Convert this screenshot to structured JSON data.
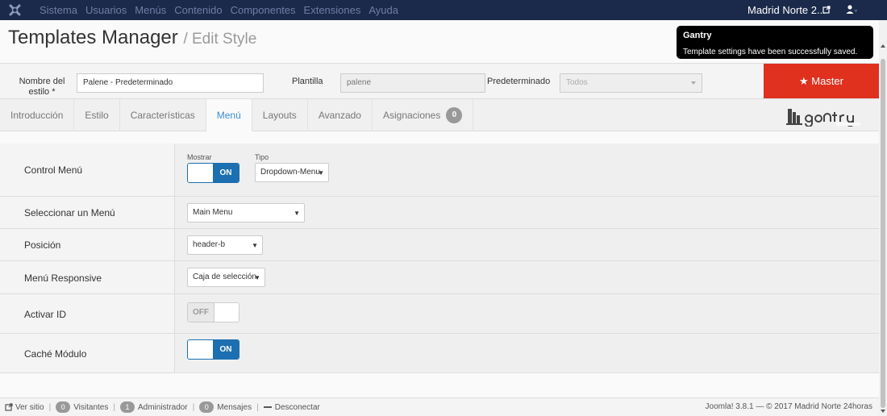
{
  "navbar": {
    "menu": [
      "Sistema",
      "Usuarios",
      "Menús",
      "Contenido",
      "Componentes",
      "Extensiones",
      "Ayuda"
    ],
    "site_name": "Madrid Norte 2..."
  },
  "header": {
    "title": "Templates Manager",
    "subtitle": "/ Edit Style"
  },
  "toast": {
    "title": "Gantry",
    "message": "Template settings have been successfully saved."
  },
  "stylebar": {
    "style_name_label": "Nombre del estilo *",
    "style_name_value": "Palene - Predeterminado",
    "template_label": "Plantilla",
    "template_value": "palene",
    "default_label": "Predeterminado",
    "default_value": "Todos",
    "master_label": "★ Master"
  },
  "tabs": [
    {
      "label": "Introducción",
      "active": false
    },
    {
      "label": "Estilo",
      "active": false
    },
    {
      "label": "Características",
      "active": false
    },
    {
      "label": "Menú",
      "active": true
    },
    {
      "label": "Layouts",
      "active": false
    },
    {
      "label": "Avanzado",
      "active": false
    },
    {
      "label": "Asignaciones",
      "active": false,
      "count": "0"
    }
  ],
  "rows": {
    "control": {
      "label": "Control Menú",
      "show_label": "Mostrar",
      "show_state": "ON",
      "type_label": "Tipo",
      "type_value": "Dropdown-Menu"
    },
    "select_menu": {
      "label": "Seleccionar un Menú",
      "value": "Main Menu"
    },
    "position": {
      "label": "Posición",
      "value": "header-b"
    },
    "responsive": {
      "label": "Menú Responsive",
      "value": "Caja de selección"
    },
    "activate_id": {
      "label": "Activar ID",
      "state": "OFF"
    },
    "module_cache": {
      "label": "Caché Módulo",
      "state": "ON"
    }
  },
  "status": {
    "view_site": "Ver sitio",
    "visitors_count": "0",
    "visitors_label": "Visitantes",
    "admins_count": "1",
    "admins_label": "Administrador",
    "messages_count": "0",
    "messages_label": "Mensajes",
    "logout": "Desconectar",
    "footer": "Joomla! 3.8.1 — © 2017 Madrid Norte 24horas"
  },
  "colors": {
    "navbar": "#1b2a4a",
    "accent": "#1c6fb0",
    "master": "#e0301e",
    "tab_active": "#3d8ed4"
  }
}
